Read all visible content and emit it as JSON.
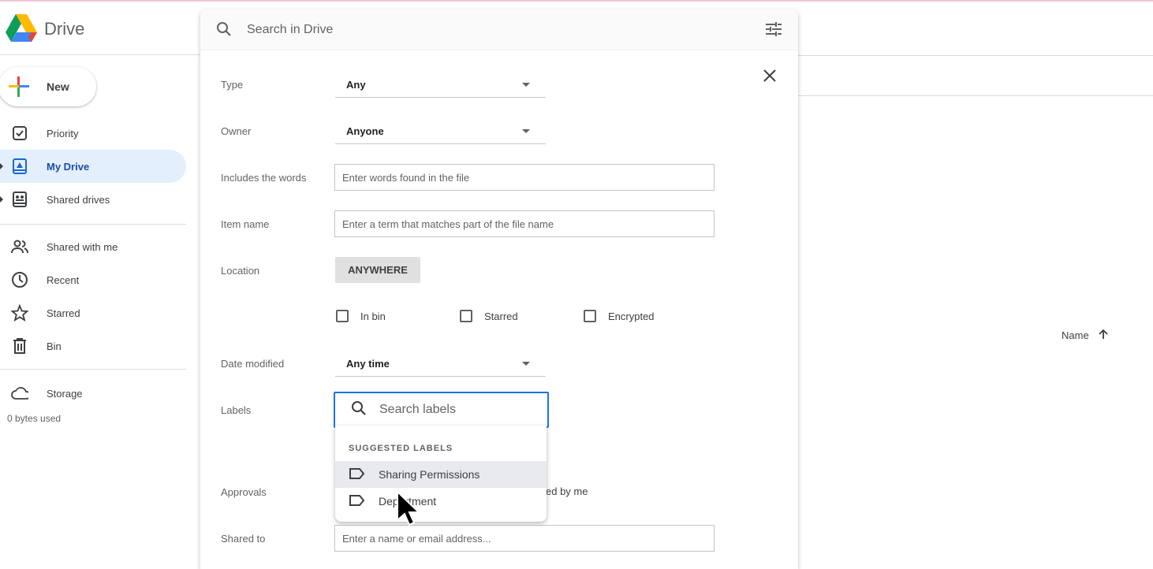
{
  "app": {
    "title": "Drive"
  },
  "sidebar": {
    "new_label": "New",
    "items": [
      {
        "label": "Priority",
        "icon": "priority-icon"
      },
      {
        "label": "My Drive",
        "icon": "my-drive-icon",
        "active": true
      },
      {
        "label": "Shared drives",
        "icon": "shared-drives-icon"
      },
      {
        "label": "Shared with me",
        "icon": "people-icon"
      },
      {
        "label": "Recent",
        "icon": "clock-icon"
      },
      {
        "label": "Starred",
        "icon": "star-icon"
      },
      {
        "label": "Bin",
        "icon": "trash-icon"
      },
      {
        "label": "Storage",
        "icon": "cloud-icon"
      }
    ],
    "storage_used": "0 bytes used"
  },
  "search": {
    "placeholder": "Search in Drive"
  },
  "list": {
    "sort_label": "Name"
  },
  "advanced": {
    "type": {
      "label": "Type",
      "value": "Any"
    },
    "owner": {
      "label": "Owner",
      "value": "Anyone"
    },
    "words": {
      "label": "Includes the words",
      "placeholder": "Enter words found in the file"
    },
    "item_name": {
      "label": "Item name",
      "placeholder": "Enter a term that matches part of the file name"
    },
    "location": {
      "label": "Location",
      "button": "ANYWHERE"
    },
    "checkboxes": [
      {
        "label": "In bin",
        "checked": false
      },
      {
        "label": "Starred",
        "checked": false
      },
      {
        "label": "Encrypted",
        "checked": false
      }
    ],
    "date_modified": {
      "label": "Date modified",
      "value": "Any time"
    },
    "labels": {
      "label": "Labels",
      "placeholder": "Search labels",
      "suggested_header": "SUGGESTED LABELS",
      "suggestions": [
        "Sharing Permissions",
        "Department"
      ]
    },
    "approvals": {
      "label": "Approvals",
      "partial_option": "ed by me"
    },
    "shared_to": {
      "label": "Shared to",
      "placeholder": "Enter a name or email address..."
    }
  },
  "colors": {
    "accent": "#1a73e8",
    "active_bg": "#e4effd",
    "active_text": "#174ea6"
  }
}
